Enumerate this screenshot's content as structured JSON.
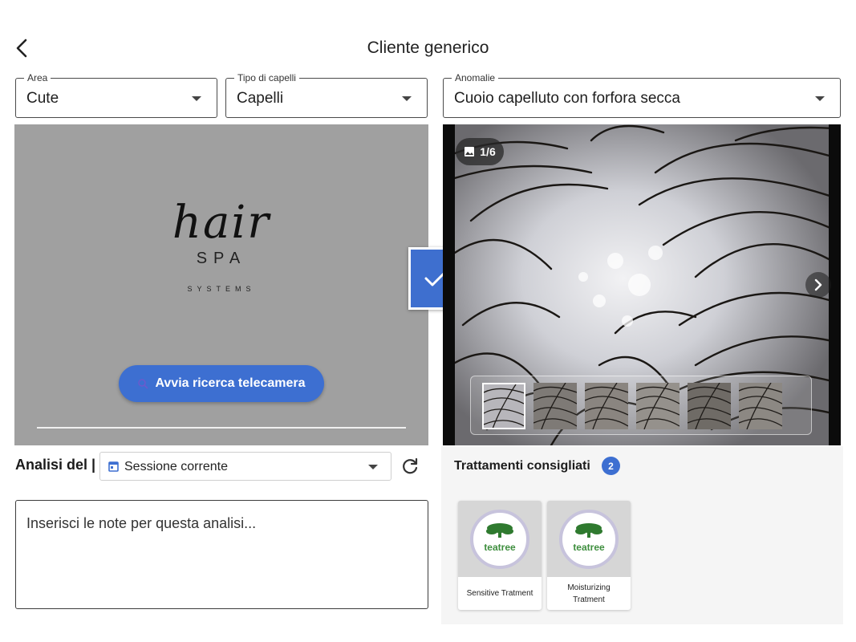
{
  "header": {
    "title": "Cliente generico",
    "back_icon": "chevron-left-icon"
  },
  "filters": {
    "area": {
      "label": "Area",
      "value": "Cute"
    },
    "hair_type": {
      "label": "Tipo di capelli",
      "value": "Capelli"
    },
    "anomalies": {
      "label": "Anomalie",
      "value": "Cuoio capelluto con forfora secca"
    }
  },
  "camera": {
    "logo_hair": "hair",
    "logo_spa": "SPA",
    "logo_systems": "SYSTEMS",
    "start_button": "Avvia ricerca telecamera",
    "start_icon": "search-icon"
  },
  "confirm": {
    "checked": true,
    "icon": "check-icon"
  },
  "viewer": {
    "counter": "1/6",
    "counter_icon": "image-icon",
    "next_icon": "chevron-right-icon",
    "thumb_count": 6,
    "active_thumb": 0
  },
  "analysis": {
    "label": "Analisi del |",
    "session": "Sessione corrente",
    "session_icon": "calendar-icon",
    "refresh_icon": "refresh-icon"
  },
  "notes": {
    "placeholder": "Inserisci le note per questa analisi..."
  },
  "treatments": {
    "title": "Trattamenti consigliati",
    "count": "2",
    "items": [
      {
        "name": "Sensitive Tratment",
        "brand": "teatree"
      },
      {
        "name": "Moisturizing Tratment",
        "brand": "teatree"
      }
    ]
  },
  "colors": {
    "accent": "#3d6fd1",
    "panel_gray": "#a0a0a0",
    "treatment_bg": "#f5f5f5"
  }
}
